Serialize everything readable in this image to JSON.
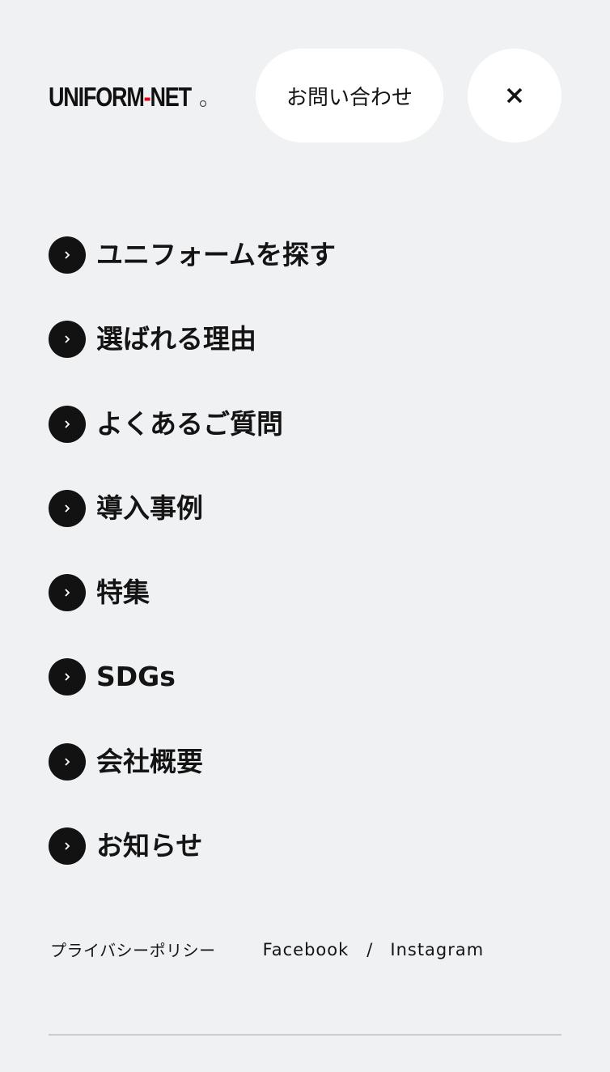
{
  "header": {
    "logo": {
      "part1": "UNIFORM",
      "dash": "-",
      "part2": "NET",
      "brand_color": "#e60012"
    },
    "contact_label": "お問い合わせ",
    "close_icon": "close-icon"
  },
  "nav": {
    "arrow_icon": "chevron-right-icon",
    "items": [
      {
        "label": "ユニフォームを探す"
      },
      {
        "label": "選ばれる理由"
      },
      {
        "label": "よくあるご質問"
      },
      {
        "label": "導入事例"
      },
      {
        "label": "特集"
      },
      {
        "label": "SDGs"
      },
      {
        "label": "会社概要"
      },
      {
        "label": "お知らせ"
      }
    ]
  },
  "footer": {
    "privacy_label": "プライバシーポリシー",
    "facebook_label": "Facebook",
    "separator": "/",
    "instagram_label": "Instagram"
  },
  "colors": {
    "background": "#f0f1f3",
    "button_bg": "#ffffff",
    "arrow_bg": "#121212",
    "text": "#141414",
    "divider": "#c9cbce"
  }
}
